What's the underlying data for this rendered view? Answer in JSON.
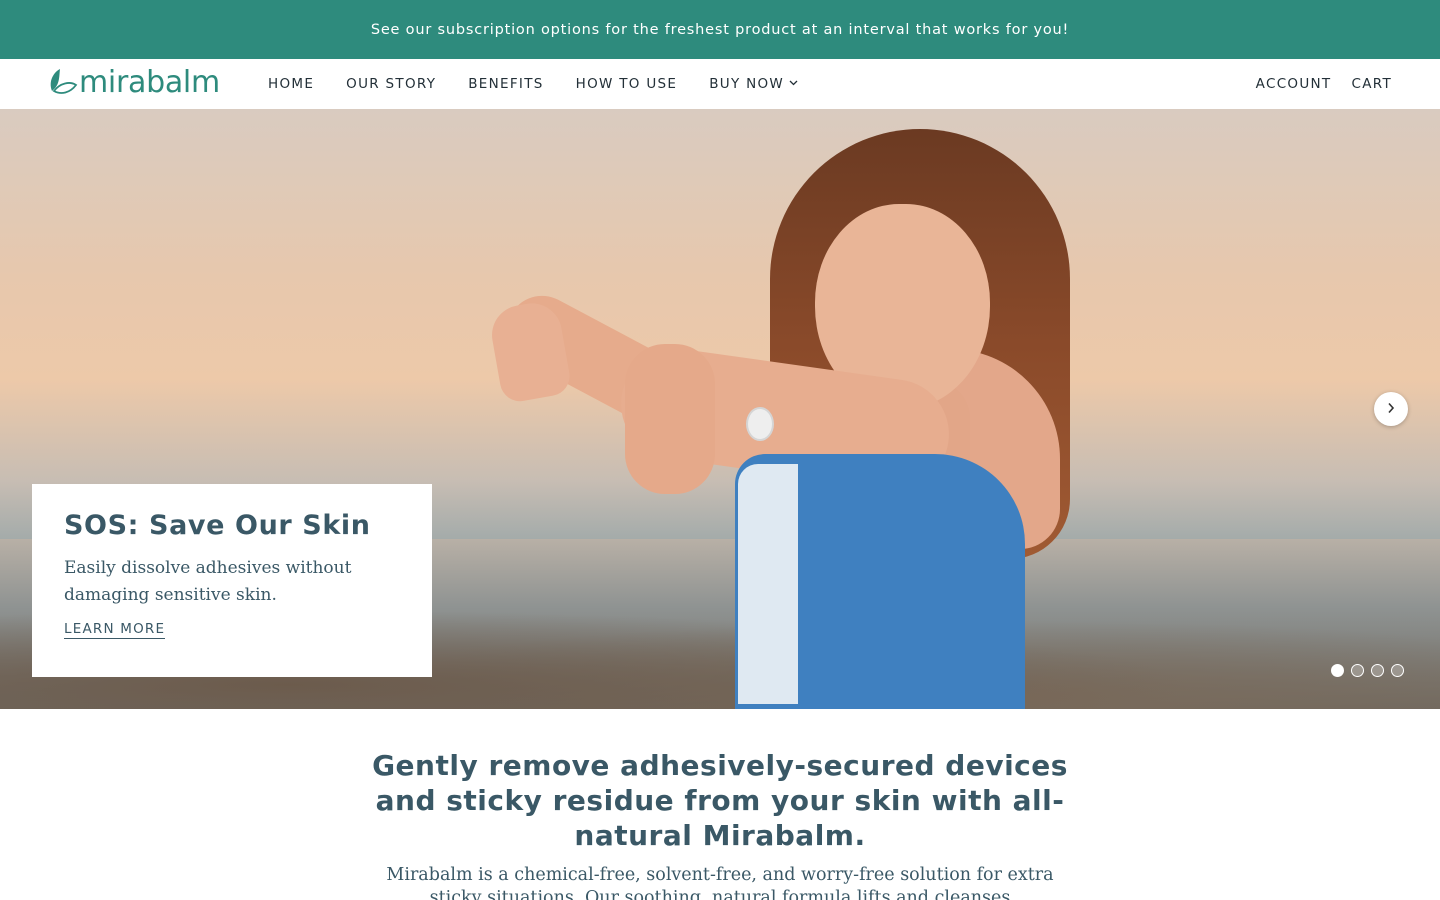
{
  "announcement": {
    "text": "See our subscription options for the freshest product at an interval that works for you!"
  },
  "brand": {
    "name": "mirabalm",
    "color": "#2e8b7d",
    "logo_icon": "leaf-icon"
  },
  "nav": {
    "items": [
      {
        "label": "HOME"
      },
      {
        "label": "OUR STORY"
      },
      {
        "label": "BENEFITS"
      },
      {
        "label": "HOW TO USE"
      },
      {
        "label": "BUY NOW",
        "icon": "chevron-down-icon"
      }
    ],
    "right": [
      {
        "label": "ACCOUNT"
      },
      {
        "label": "CART"
      }
    ]
  },
  "hero": {
    "title": "SOS: Save Our Skin",
    "text": "Easily dissolve adhesives without damaging sensitive skin.",
    "link": "LEARN MORE",
    "next_icon": "chevron-right-icon",
    "slides_total": 4,
    "active_slide": 1
  },
  "intro": {
    "heading": "Gently remove adhesively-secured devices and sticky residue from your skin with all-natural Mirabalm.",
    "body": "Mirabalm is a chemical-free, solvent-free, and worry-free solution for extra sticky situations. Our soothing, natural formula lifts and cleanses"
  },
  "colors": {
    "announcement_bg": "#2e8b7d",
    "heading": "#3a5866",
    "nav_text": "#233038"
  }
}
